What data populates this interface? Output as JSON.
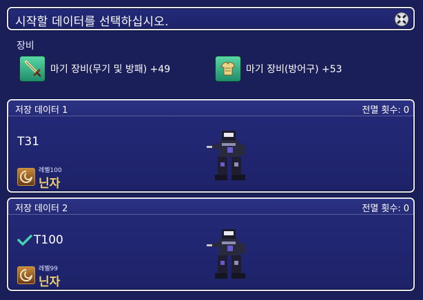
{
  "header": {
    "title": "시작할 데이터를 선택하십시오.",
    "close_icon": "close-icon"
  },
  "equipment": {
    "label": "장비",
    "items": [
      {
        "icon": "sword-icon",
        "text": "마기 장비(무기 및 방패) +49"
      },
      {
        "icon": "armor-icon",
        "text": "마기 장비(방어구) +53"
      }
    ]
  },
  "slots": [
    {
      "name": "저장 데이터 1",
      "wipe_label": "전멸 횟수:",
      "wipe_count": "0",
      "tag": "T31",
      "level": "레벨100",
      "job": "닌자",
      "job_icon": "ninja-job-icon",
      "selected": false
    },
    {
      "name": "저장 데이터 2",
      "wipe_label": "전멸 횟수:",
      "wipe_count": "0",
      "tag": "T100",
      "level": "레벨99",
      "job": "닌자",
      "job_icon": "ninja-job-icon",
      "selected": true
    }
  ],
  "colors": {
    "background": "#1a1f5a",
    "panel": "#252a7a",
    "accent_gold": "#f2d271",
    "check": "#4ad0b0",
    "border": "#e8e8f0"
  }
}
